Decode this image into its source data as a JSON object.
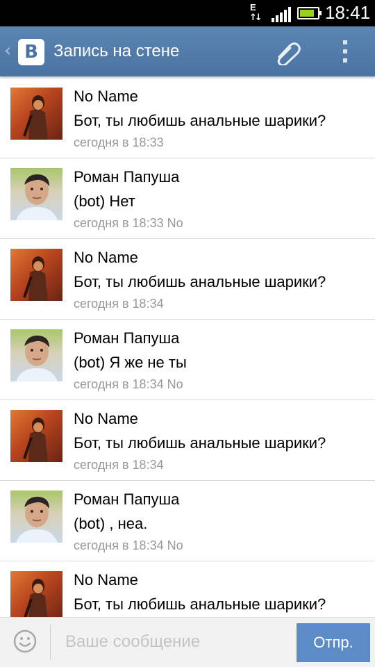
{
  "status_bar": {
    "network_label": "E",
    "time": "18:41",
    "battery_level": 0.85
  },
  "header": {
    "title": "Запись на стене",
    "logo_letter": "В",
    "back_glyph": "‹"
  },
  "messages": [
    {
      "author": "No Name",
      "text": "Бот, ты любишь анальные шарики?",
      "meta": "сегодня в 18:33",
      "avatar": "woman-avatar"
    },
    {
      "author": "Роман Папуша",
      "text": "(bot)  Нет",
      "meta": "сегодня в 18:33 No",
      "avatar": "man-avatar"
    },
    {
      "author": "No Name",
      "text": "Бот, ты любишь анальные шарики?",
      "meta": "сегодня в 18:34",
      "avatar": "woman-avatar"
    },
    {
      "author": "Роман Папуша",
      "text": "(bot)  Я же не ты",
      "meta": "сегодня в 18:34 No",
      "avatar": "man-avatar"
    },
    {
      "author": "No Name",
      "text": "Бот, ты любишь анальные шарики?",
      "meta": "сегодня в 18:34",
      "avatar": "woman-avatar"
    },
    {
      "author": "Роман Папуша",
      "text": "(bot)  , неа.",
      "meta": "сегодня в 18:34 No",
      "avatar": "man-avatar"
    },
    {
      "author": "No Name",
      "text": "Бот, ты любишь анальные шарики?",
      "meta": "",
      "avatar": "woman-avatar"
    }
  ],
  "composer": {
    "placeholder": "Ваше сообщение",
    "send_label": "Отпр."
  },
  "colors": {
    "header": "#4a73a1",
    "send_button": "#5b8cc5",
    "meta_text": "#999999"
  }
}
